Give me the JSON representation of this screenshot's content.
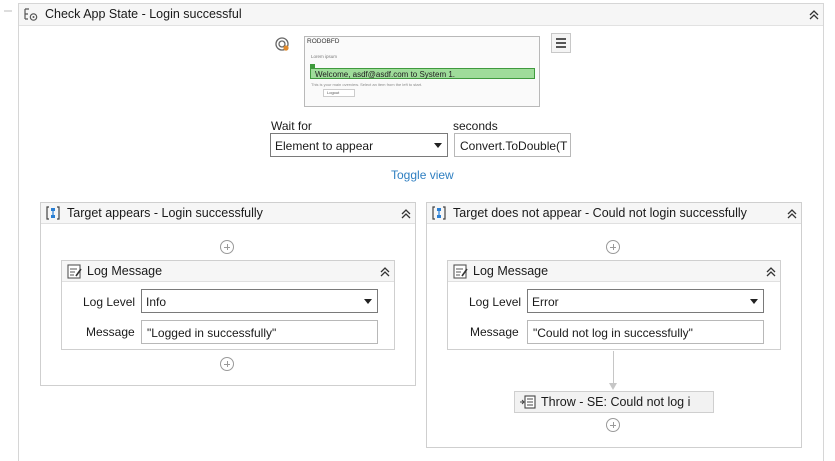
{
  "outer": {
    "title": "Check App State - Login successful"
  },
  "screenshot": {
    "title": "RODOBFD",
    "sub": "Lorem ipsum",
    "welcome_text": "Welcome, asdf@asdf.com to System 1.",
    "line_text": "This is your main overview. Select an item from the left to start.",
    "button_text": "Logout"
  },
  "wait_for": {
    "label": "Wait for",
    "value": "Element to appear"
  },
  "seconds": {
    "label": "seconds",
    "value": "Convert.ToDouble(T"
  },
  "toggle_view": "Toggle view",
  "appears": {
    "title": "Target appears - Login successfully",
    "log": {
      "title": "Log Message",
      "level_label": "Log Level",
      "level_value": "Info",
      "message_label": "Message",
      "message_value": "\"Logged in successfully\""
    }
  },
  "not_appears": {
    "title": "Target does not appear - Could not login successfully",
    "log": {
      "title": "Log Message",
      "level_label": "Log Level",
      "level_value": "Error",
      "message_label": "Message",
      "message_value": "\"Could not log in successfully\""
    },
    "throw": {
      "title": "Throw - SE: Could not log i"
    }
  },
  "colors": {
    "accent_link": "#2f7fc1",
    "highlight_green": "#9fdc9a",
    "container_icon_blue": "#2a7fd4"
  }
}
